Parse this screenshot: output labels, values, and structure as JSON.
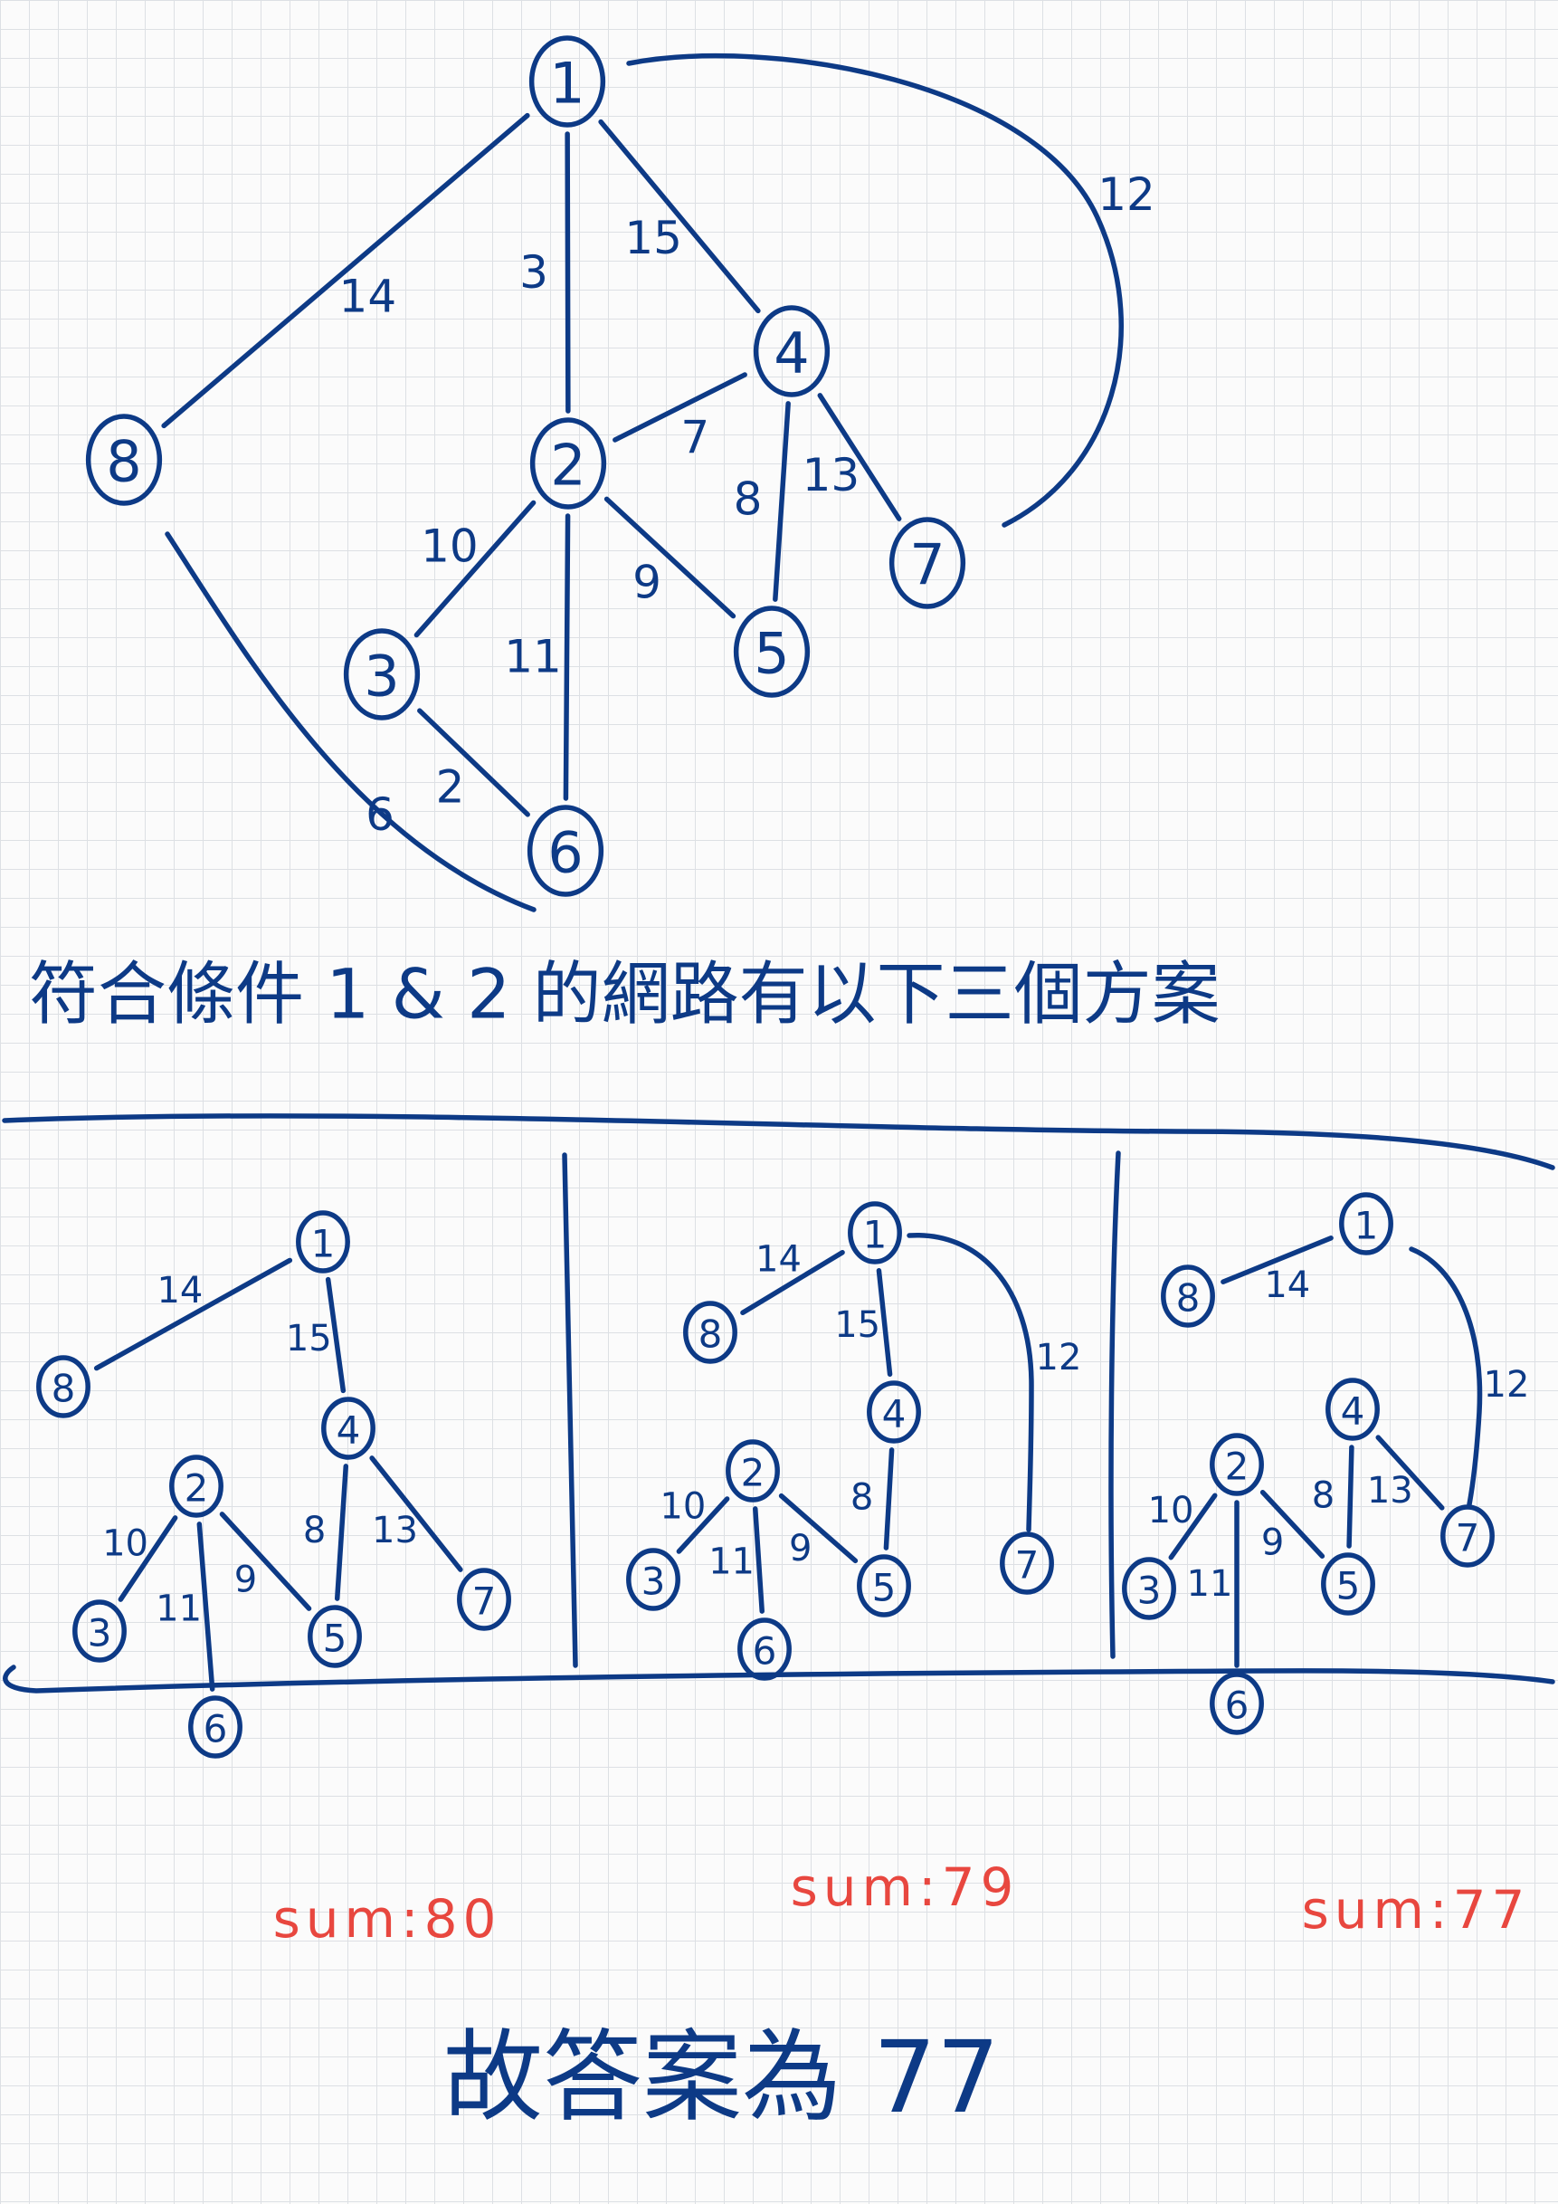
{
  "colors": {
    "ink": "#0d3a86",
    "red": "#e8473f"
  },
  "note": {
    "condition_line": "符合條件 1 & 2 的網路有以下三個方案",
    "conclusion": "故答案為 77"
  },
  "main_graph": {
    "nodes": [
      "1",
      "2",
      "3",
      "4",
      "5",
      "6",
      "7",
      "8"
    ],
    "edges": [
      {
        "from": "8",
        "to": "1",
        "weight": "14"
      },
      {
        "from": "1",
        "to": "2",
        "weight": "3"
      },
      {
        "from": "1",
        "to": "4",
        "weight": "15"
      },
      {
        "from": "1",
        "to": "7",
        "weight": "12"
      },
      {
        "from": "2",
        "to": "4",
        "weight": "7"
      },
      {
        "from": "4",
        "to": "5",
        "weight": "8"
      },
      {
        "from": "4",
        "to": "7",
        "weight": "13"
      },
      {
        "from": "2",
        "to": "3",
        "weight": "10"
      },
      {
        "from": "2",
        "to": "5",
        "weight": "9"
      },
      {
        "from": "2",
        "to": "6",
        "weight": "11"
      },
      {
        "from": "3",
        "to": "6",
        "weight": "2"
      },
      {
        "from": "8",
        "to": "6",
        "weight": "6"
      }
    ]
  },
  "plans": [
    {
      "edges": [
        {
          "from": "1",
          "to": "8",
          "weight": "14"
        },
        {
          "from": "1",
          "to": "4",
          "weight": "15"
        },
        {
          "from": "4",
          "to": "7",
          "weight": "13"
        },
        {
          "from": "4",
          "to": "5",
          "weight": "8"
        },
        {
          "from": "2",
          "to": "3",
          "weight": "10"
        },
        {
          "from": "2",
          "to": "6",
          "weight": "11"
        },
        {
          "from": "2",
          "to": "5",
          "weight": "9"
        }
      ],
      "sum_label": "sum:80"
    },
    {
      "edges": [
        {
          "from": "1",
          "to": "8",
          "weight": "14"
        },
        {
          "from": "1",
          "to": "4",
          "weight": "15"
        },
        {
          "from": "1",
          "to": "7",
          "weight": "12"
        },
        {
          "from": "4",
          "to": "5",
          "weight": "8"
        },
        {
          "from": "2",
          "to": "3",
          "weight": "10"
        },
        {
          "from": "2",
          "to": "6",
          "weight": "11"
        },
        {
          "from": "2",
          "to": "5",
          "weight": "9"
        }
      ],
      "sum_label": "sum:79"
    },
    {
      "edges": [
        {
          "from": "8",
          "to": "1",
          "weight": "14"
        },
        {
          "from": "1",
          "to": "7",
          "weight": "12"
        },
        {
          "from": "4",
          "to": "7",
          "weight": "13"
        },
        {
          "from": "4",
          "to": "5",
          "weight": "8"
        },
        {
          "from": "2",
          "to": "3",
          "weight": "10"
        },
        {
          "from": "2",
          "to": "5",
          "weight": "9"
        },
        {
          "from": "2",
          "to": "6",
          "weight": "11"
        }
      ],
      "sum_label": "sum:77"
    }
  ]
}
